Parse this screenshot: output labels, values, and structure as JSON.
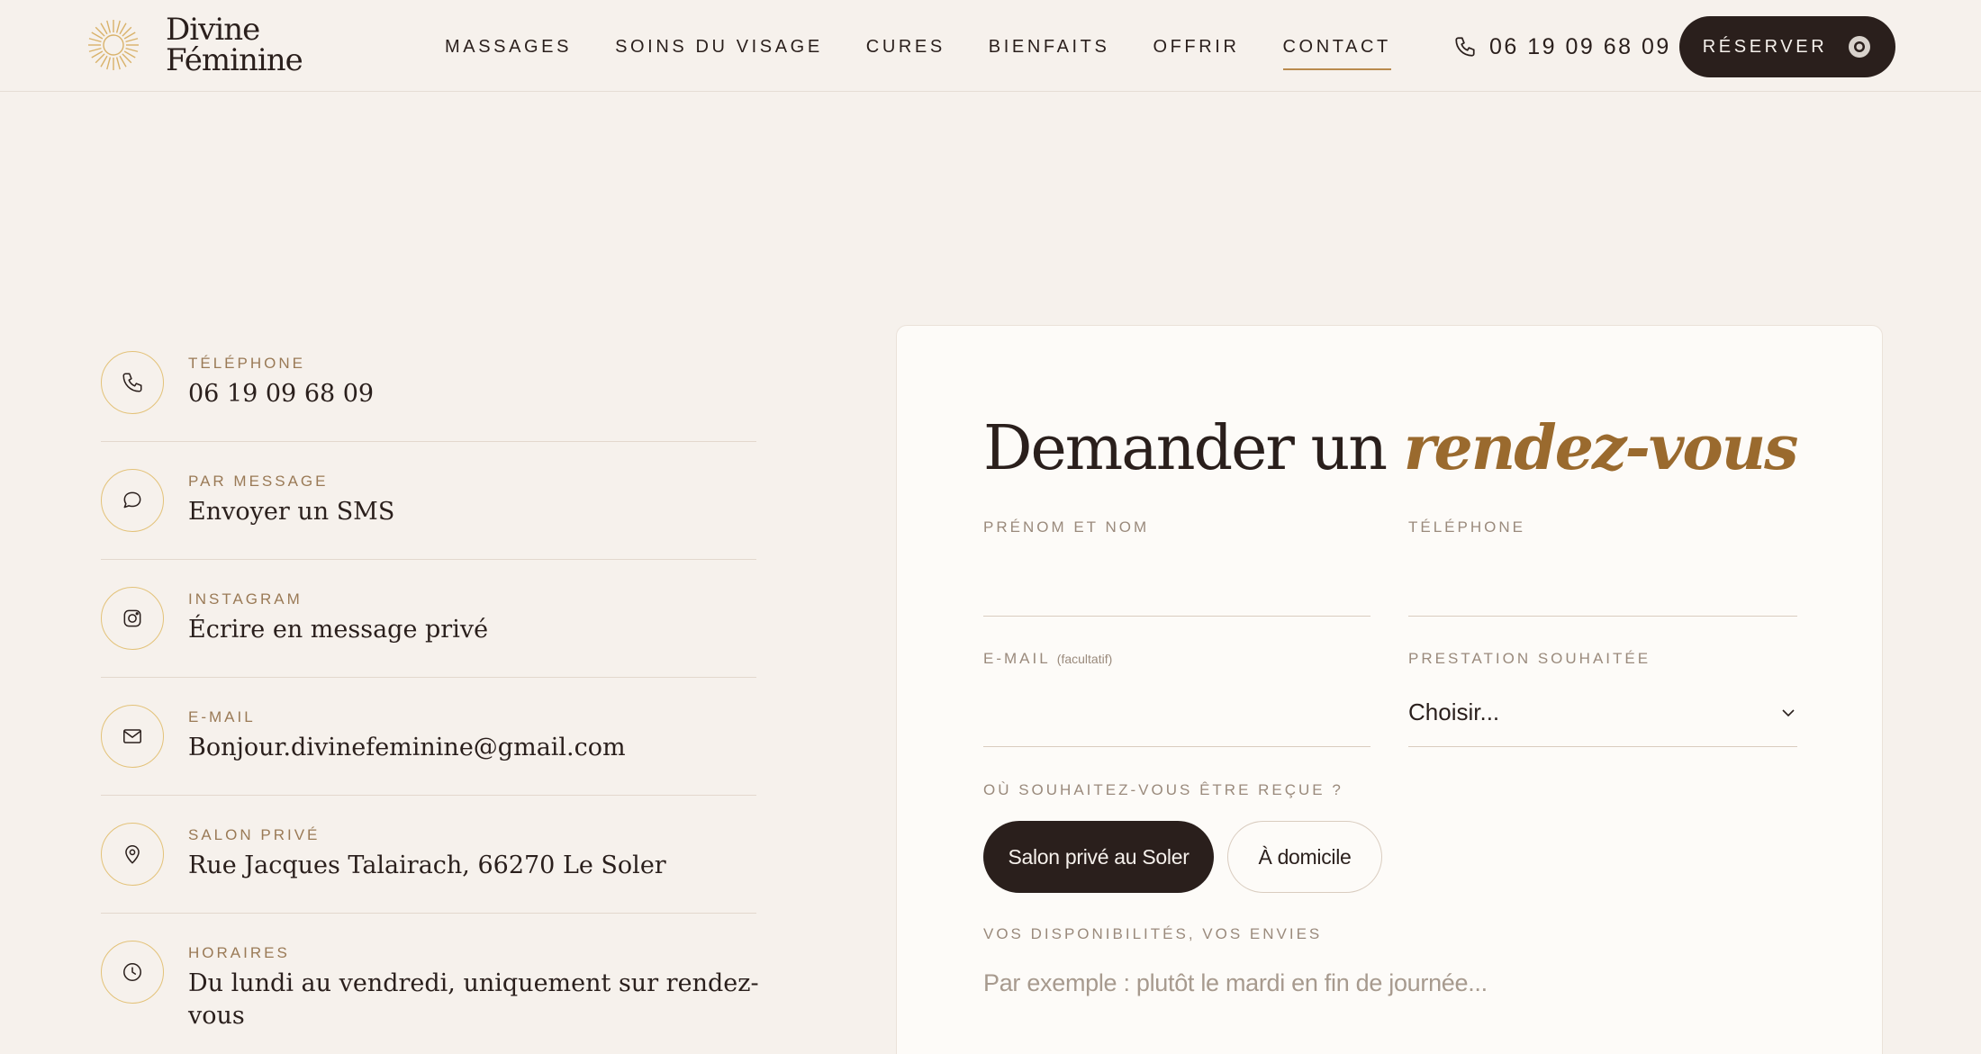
{
  "header": {
    "logo": {
      "line1": "Divine",
      "line2": "Féminine"
    },
    "nav": [
      {
        "label": "MASSAGES",
        "active": false
      },
      {
        "label": "SOINS DU VISAGE",
        "active": false
      },
      {
        "label": "CURES",
        "active": false
      },
      {
        "label": "BIENFAITS",
        "active": false
      },
      {
        "label": "OFFRIR",
        "active": false
      },
      {
        "label": "CONTACT",
        "active": true
      }
    ],
    "phone": "06 19 09 68 09",
    "reserve_label": "RÉSERVER"
  },
  "contacts": [
    {
      "icon": "phone-icon",
      "label": "TÉLÉPHONE",
      "value": "06 19 09 68 09"
    },
    {
      "icon": "chat-icon",
      "label": "PAR MESSAGE",
      "value": "Envoyer un SMS"
    },
    {
      "icon": "instagram-icon",
      "label": "INSTAGRAM",
      "value": "Écrire en message privé"
    },
    {
      "icon": "mail-icon",
      "label": "E-MAIL",
      "value": "Bonjour.divinefeminine@gmail.com"
    },
    {
      "icon": "location-pin-icon",
      "label": "SALON PRIVÉ",
      "value": "Rue Jacques Talairach, 66270 Le Soler"
    },
    {
      "icon": "clock-icon",
      "label": "HORAIRES",
      "value": "Du lundi au vendredi, uniquement sur rendez-vous"
    }
  ],
  "form": {
    "title_plain": "Demander un",
    "title_accent": "rendez-vous",
    "name_label": "PRÉNOM ET NOM",
    "name_value": "",
    "phone_label": "TÉLÉPHONE",
    "phone_value": "",
    "email_label": "E-MAIL",
    "email_optional": "(facultatif)",
    "email_value": "",
    "service_label": "PRESTATION SOUHAITÉE",
    "service_selected": "Choisir...",
    "location_label": "OÙ SOUHAITEZ-VOUS ÊTRE REÇUE ?",
    "location_options": [
      "Salon privé au Soler",
      "À domicile"
    ],
    "location_selected": 0,
    "availability_label": "VOS DISPONIBILITÉS, VOS ENVIES",
    "availability_placeholder": "Par exemple : plutôt le mardi en fin de journée..."
  },
  "colors": {
    "accent": "#9a6a2e",
    "dark": "#2a1f1c",
    "gold": "#e3c278",
    "bg": "#f6f1ec"
  }
}
